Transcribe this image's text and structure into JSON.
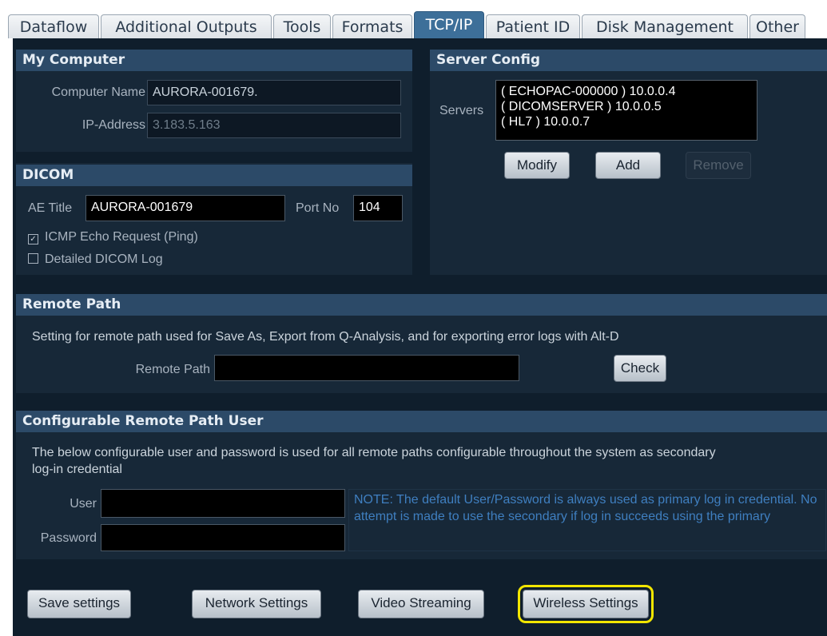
{
  "tabs": [
    {
      "label": "Dataflow",
      "active": false
    },
    {
      "label": "Additional Outputs",
      "active": false
    },
    {
      "label": "Tools",
      "active": false
    },
    {
      "label": "Formats",
      "active": false
    },
    {
      "label": "TCP/IP",
      "active": true
    },
    {
      "label": "Patient ID",
      "active": false
    },
    {
      "label": "Disk Management",
      "active": false
    },
    {
      "label": "Other",
      "active": false
    }
  ],
  "my_computer": {
    "title": "My Computer",
    "computer_name_label": "Computer Name",
    "computer_name_value": "AURORA-001679.",
    "ip_label": "IP-Address",
    "ip_value": "3.183.5.163"
  },
  "server_config": {
    "title": "Server Config",
    "servers_label": "Servers",
    "servers": [
      "( ECHOPAC-000000 ) 10.0.0.4",
      "( DICOMSERVER ) 10.0.0.5",
      "( HL7 ) 10.0.0.7"
    ],
    "modify_label": "Modify",
    "add_label": "Add",
    "remove_label": "Remove"
  },
  "dicom": {
    "title": "DICOM",
    "ae_title_label": "AE Title",
    "ae_title_value": "AURORA-001679",
    "port_label": "Port No",
    "port_value": "104",
    "icmp_label": "ICMP Echo Request (Ping)",
    "icmp_checked": true,
    "detailed_log_label": "Detailed DICOM Log",
    "detailed_log_checked": false
  },
  "remote_path": {
    "title": "Remote Path",
    "description": "Setting for remote path used for Save As, Export from Q-Analysis, and for exporting error logs with Alt-D",
    "path_label": "Remote Path",
    "path_value": "",
    "check_label": "Check"
  },
  "remote_user": {
    "title": "Configurable Remote Path User",
    "description": "The below configurable user and password is used for all remote paths configurable throughout the system as secondary log-in credential",
    "user_label": "User",
    "user_value": "",
    "password_label": "Password",
    "password_value": "",
    "note": "NOTE: The default User/Password is always used as primary log in credential. No attempt is made to use the secondary if log in succeeds using the primary"
  },
  "footer": {
    "save_label": "Save settings",
    "network_label": "Network Settings",
    "video_label": "Video Streaming",
    "wireless_label": "Wireless Settings"
  },
  "colors": {
    "highlight": "#f2e600",
    "active_tab": "#3d6f99",
    "note_text": "#3f7fc0"
  }
}
